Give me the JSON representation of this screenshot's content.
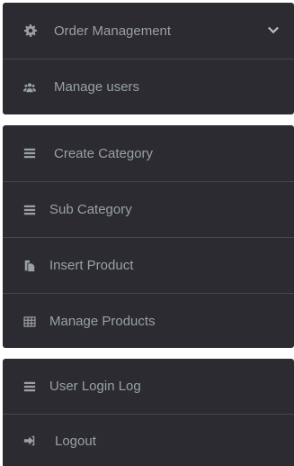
{
  "menu": {
    "group1": [
      {
        "label": "Order Management",
        "icon": "gear-icon"
      },
      {
        "label": "Manage users",
        "icon": "users-icon"
      }
    ],
    "group2": [
      {
        "label": "Create Category",
        "icon": "list-icon"
      },
      {
        "label": "Sub Category",
        "icon": "list-icon"
      },
      {
        "label": "Insert Product",
        "icon": "copy-icon"
      },
      {
        "label": "Manage Products",
        "icon": "table-icon"
      }
    ],
    "group3": [
      {
        "label": "User Login Log",
        "icon": "list-icon"
      },
      {
        "label": "Logout",
        "icon": "logout-icon"
      }
    ]
  },
  "colors": {
    "panel_bg": "#2b2b31",
    "divider": "#46464d",
    "text": "#9aa0a8"
  }
}
